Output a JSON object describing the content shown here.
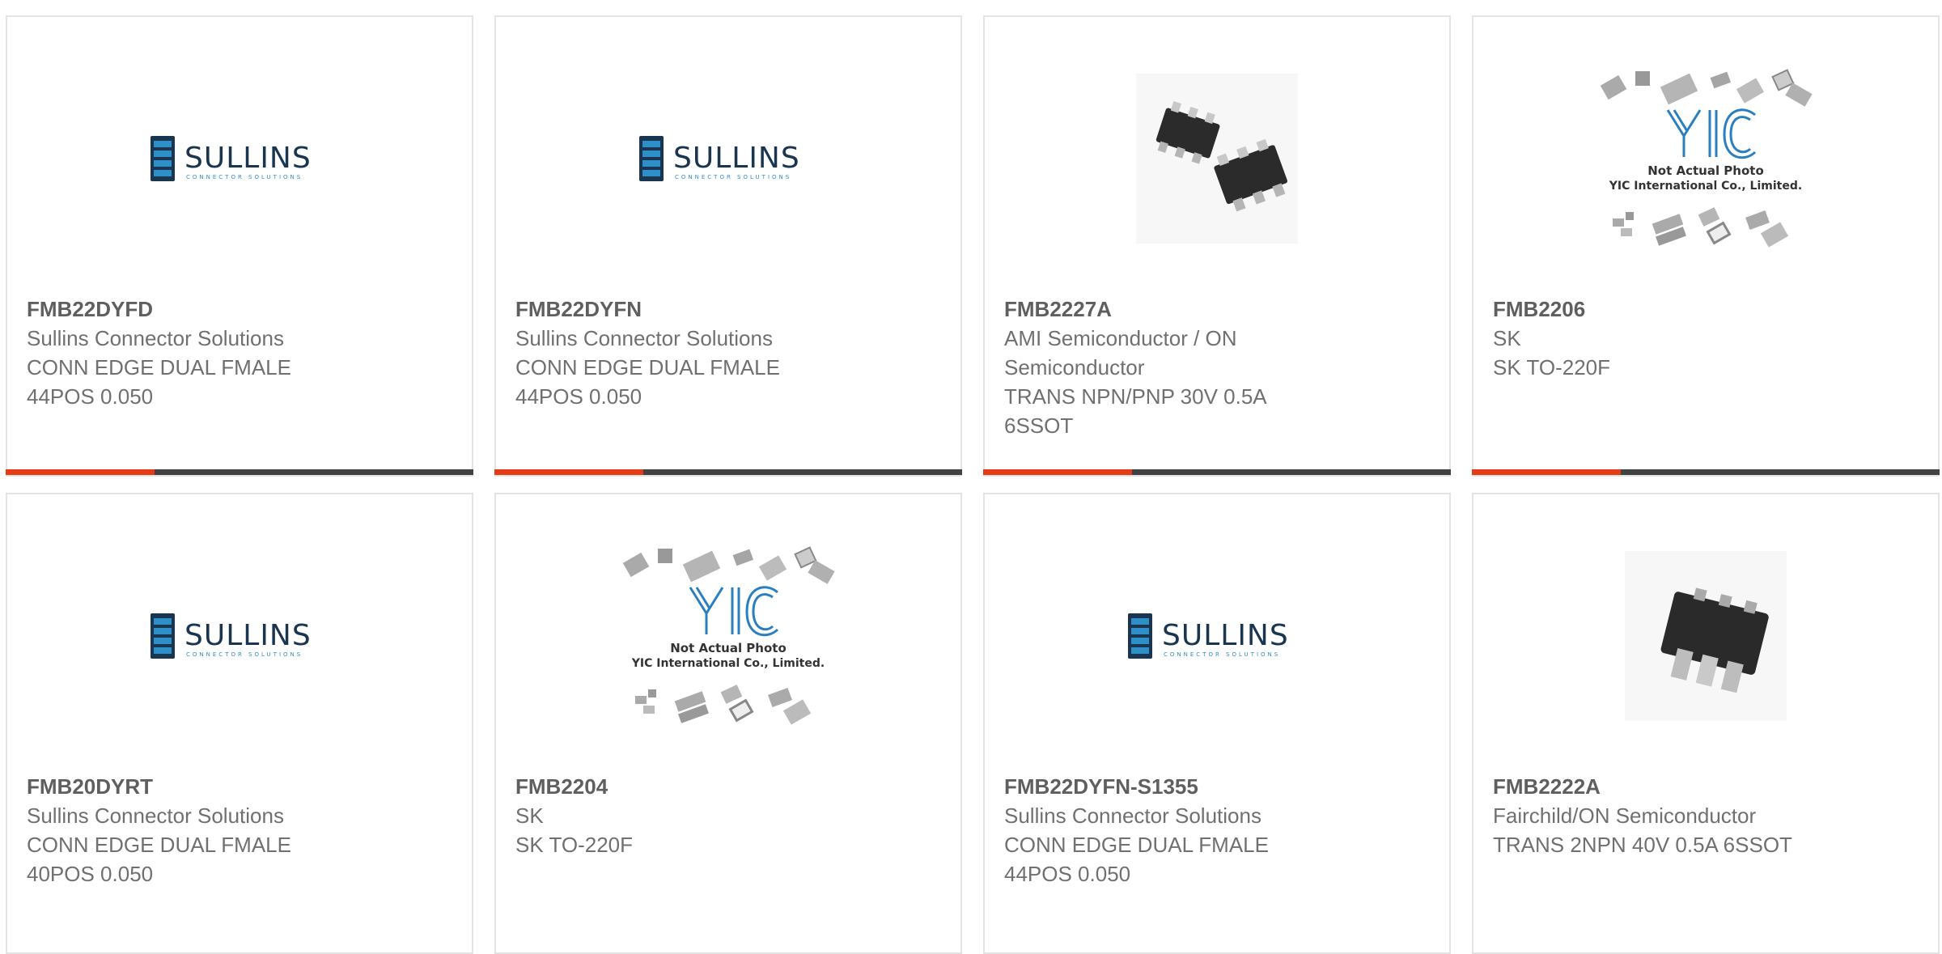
{
  "colors": {
    "accent": "#e63b17",
    "bar": "#424242",
    "border": "#e4e4e4",
    "text": "#707070"
  },
  "products": [
    {
      "part_number": "FMB22DYFD",
      "lines": [
        "Sullins Connector Solutions",
        "CONN EDGE DUAL FMALE",
        "44POS 0.050"
      ],
      "image": "sullins-logo",
      "logo_text": "SULLINS",
      "logo_sub": "CONNECTOR SOLUTIONS"
    },
    {
      "part_number": "FMB22DYFN",
      "lines": [
        "Sullins Connector Solutions",
        "CONN EDGE DUAL FMALE",
        "44POS 0.050"
      ],
      "image": "sullins-logo",
      "logo_text": "SULLINS",
      "logo_sub": "CONNECTOR SOLUTIONS"
    },
    {
      "part_number": "FMB2227A",
      "lines": [
        "AMI Semiconductor / ON",
        "Semiconductor",
        "TRANS NPN/PNP 30V 0.5A",
        "6SSOT"
      ],
      "image": "sot-chip-pair"
    },
    {
      "part_number": "FMB2206",
      "lines": [
        "SK",
        "SK TO-220F"
      ],
      "image": "yic-placeholder",
      "logo_text": "YIC",
      "caption1": "Not Actual Photo",
      "caption2": "YIC International Co., Limited."
    },
    {
      "part_number": "FMB20DYRT",
      "lines": [
        "Sullins Connector Solutions",
        "CONN EDGE DUAL FMALE",
        "40POS 0.050"
      ],
      "image": "sullins-logo",
      "logo_text": "SULLINS",
      "logo_sub": "CONNECTOR SOLUTIONS"
    },
    {
      "part_number": "FMB2204",
      "lines": [
        "SK",
        "SK TO-220F"
      ],
      "image": "yic-placeholder",
      "logo_text": "YIC",
      "caption1": "Not Actual Photo",
      "caption2": "YIC International Co., Limited."
    },
    {
      "part_number": "FMB22DYFN-S1355",
      "lines": [
        "Sullins Connector Solutions",
        "CONN EDGE DUAL FMALE",
        "44POS 0.050"
      ],
      "image": "sullins-logo",
      "logo_text": "SULLINS",
      "logo_sub": "CONNECTOR SOLUTIONS"
    },
    {
      "part_number": "FMB2222A",
      "lines": [
        "Fairchild/ON Semiconductor",
        "TRANS 2NPN 40V 0.5A 6SSOT"
      ],
      "image": "sot-chip-single"
    }
  ]
}
